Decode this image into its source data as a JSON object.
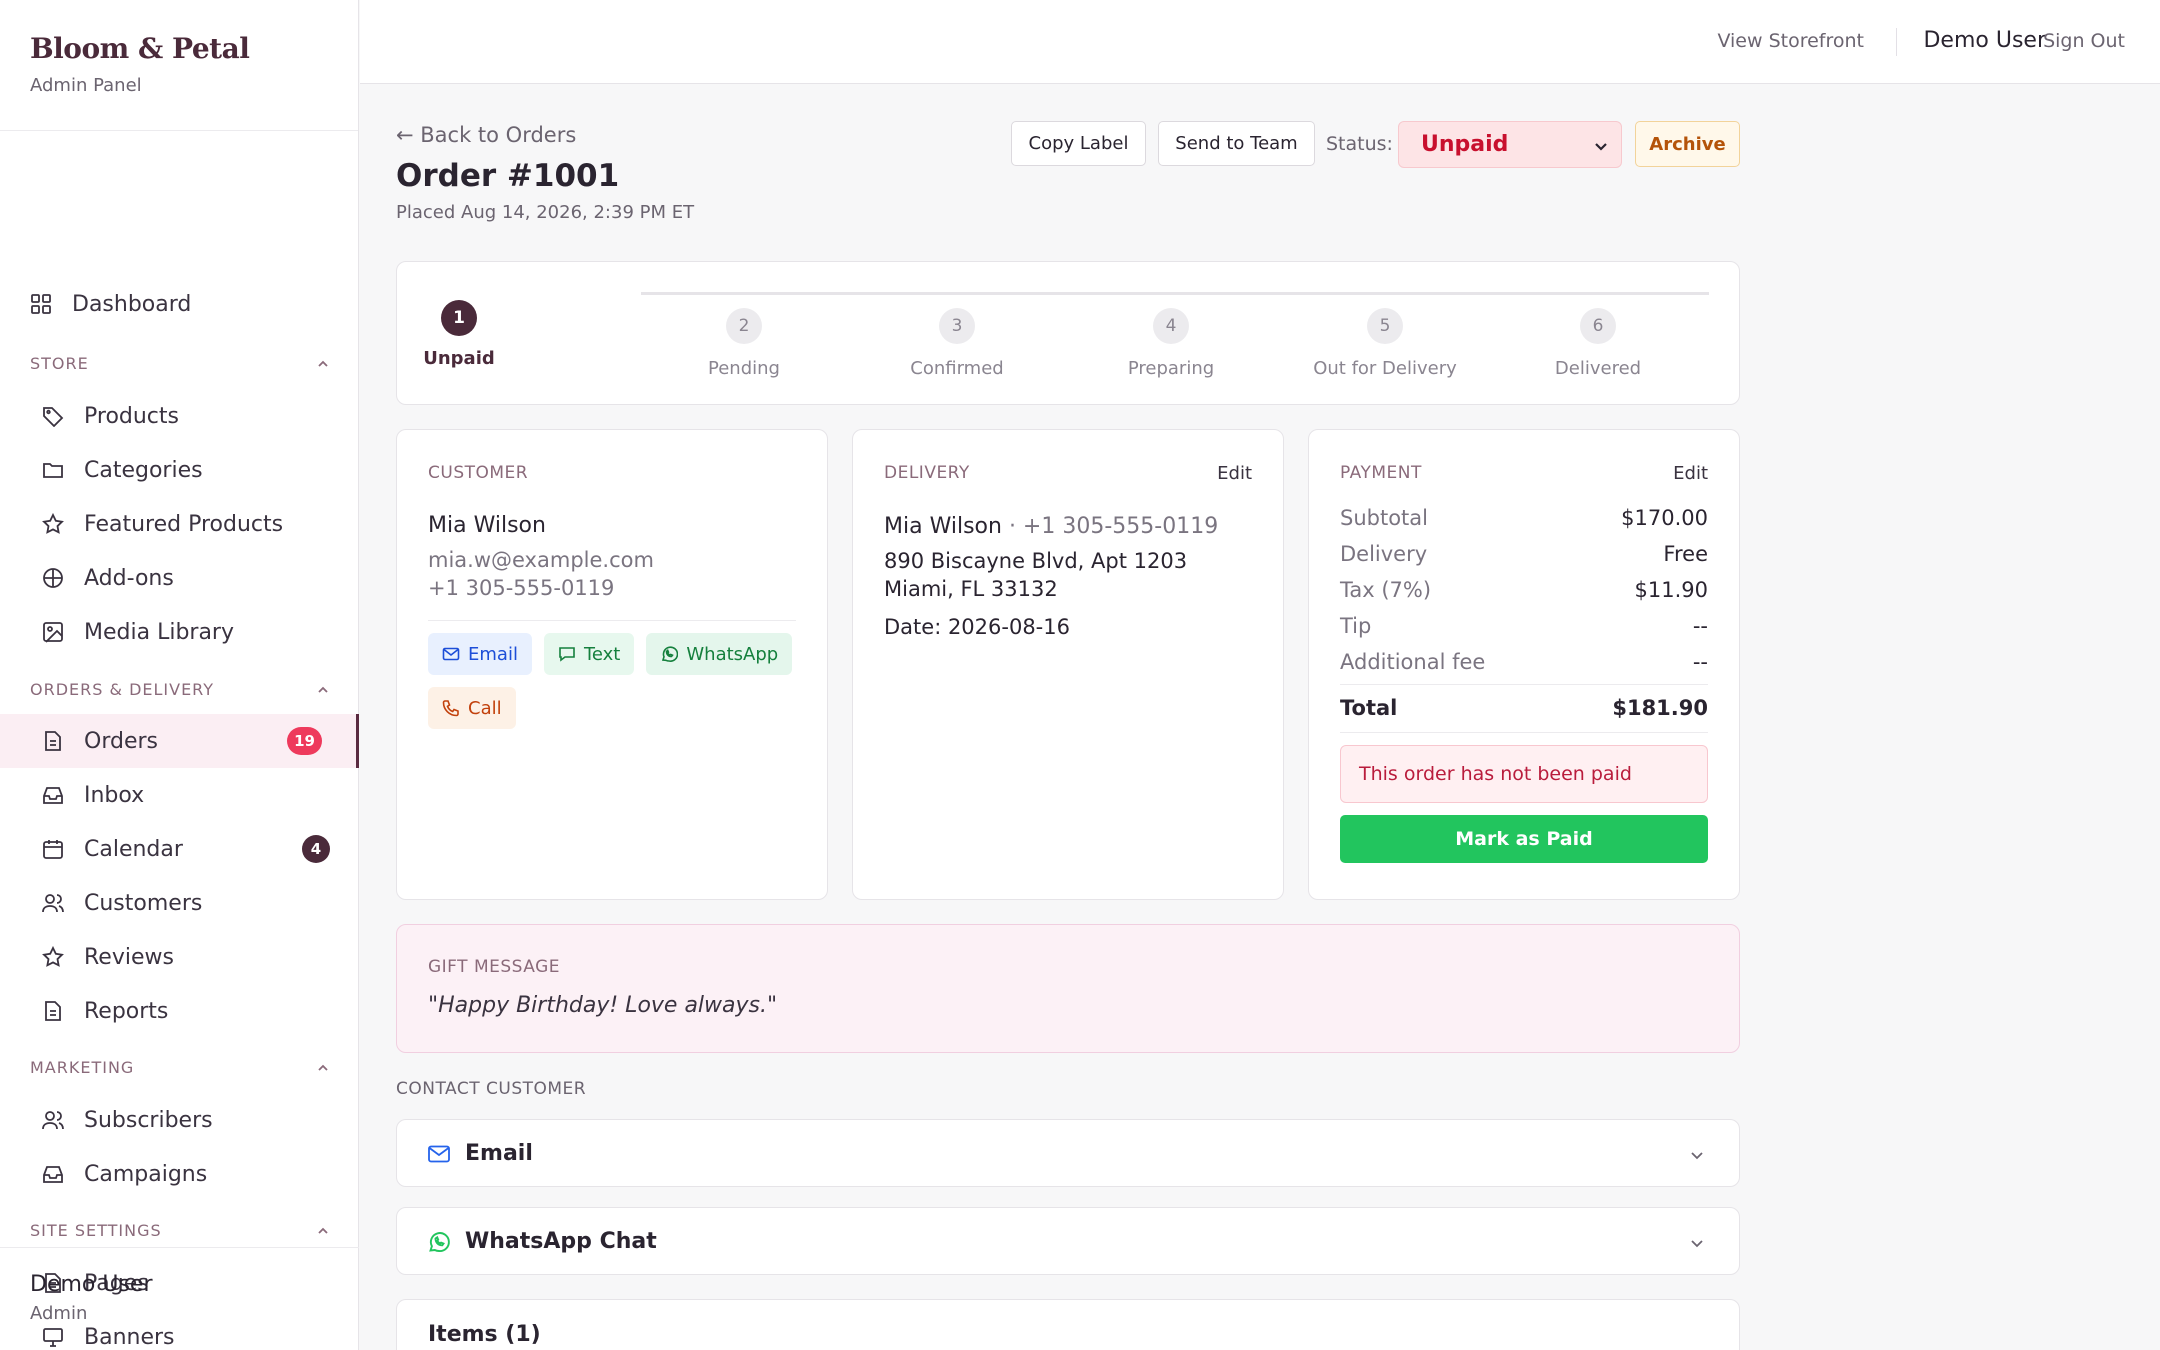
{
  "brand": {
    "title": "Bloom & Petal",
    "subtitle": "Admin Panel"
  },
  "sidebar": {
    "dashboard": "Dashboard",
    "sections": [
      {
        "title": "STORE",
        "items": [
          "Products",
          "Categories",
          "Featured Products",
          "Add-ons",
          "Media Library"
        ]
      },
      {
        "title": "ORDERS & DELIVERY",
        "items": [
          "Orders",
          "Inbox",
          "Calendar",
          "Customers",
          "Reviews",
          "Reports"
        ]
      },
      {
        "title": "MARKETING",
        "items": [
          "Subscribers",
          "Campaigns"
        ]
      },
      {
        "title": "SITE SETTINGS",
        "items": [
          "Pages",
          "Banners"
        ]
      }
    ],
    "badges": {
      "orders": "19",
      "calendar": "4"
    },
    "active_item": "Orders",
    "footer": {
      "user": "Demo User",
      "role": "Admin"
    }
  },
  "topbar": {
    "storefront": "View Storefront",
    "user": "Demo User",
    "signout": "Sign Out"
  },
  "order": {
    "back": "← Back to Orders",
    "title": "Order #1001",
    "placed": "Placed Aug 14, 2026, 2:39 PM ET",
    "actions": {
      "copy_label": "Copy Label",
      "send_team": "Send to Team",
      "status_label": "Status:",
      "status_value": "Unpaid",
      "archive": "Archive"
    },
    "steps": [
      {
        "num": "1",
        "label": "Unpaid"
      },
      {
        "num": "2",
        "label": "Pending"
      },
      {
        "num": "3",
        "label": "Confirmed"
      },
      {
        "num": "4",
        "label": "Preparing"
      },
      {
        "num": "5",
        "label": "Out for Delivery"
      },
      {
        "num": "6",
        "label": "Delivered"
      }
    ],
    "customer": {
      "header": "CUSTOMER",
      "name": "Mia Wilson",
      "email": "mia.w@example.com",
      "phone": "+1 305-555-0119",
      "chips": [
        "Email",
        "Text",
        "WhatsApp",
        "Call"
      ]
    },
    "delivery": {
      "header": "DELIVERY",
      "edit": "Edit",
      "name": "Mia Wilson",
      "phone": "· +1 305-555-0119",
      "address1": "890 Biscayne Blvd, Apt 1203",
      "address2": "Miami, FL 33132",
      "date": "Date: 2026-08-16"
    },
    "payment": {
      "header": "PAYMENT",
      "edit": "Edit",
      "rows": [
        {
          "k": "Subtotal",
          "v": "$170.00"
        },
        {
          "k": "Delivery",
          "v": "Free"
        },
        {
          "k": "Tax (7%)",
          "v": "$11.90"
        },
        {
          "k": "Tip",
          "v": "--"
        },
        {
          "k": "Additional fee",
          "v": "--"
        }
      ],
      "total_label": "Total",
      "total_value": "$181.90",
      "alert": "This order has not been paid",
      "mark_paid": "Mark as Paid"
    },
    "gift": {
      "header": "GIFT MESSAGE",
      "message": "\"Happy Birthday! Love always.\""
    },
    "contact": {
      "header": "CONTACT CUSTOMER",
      "email": "Email",
      "whatsapp": "WhatsApp Chat"
    },
    "items_header": "Items (1)"
  },
  "colors": {
    "brand": "#4a2a3a",
    "danger": "#ee3a5c",
    "success": "#22c55e"
  }
}
